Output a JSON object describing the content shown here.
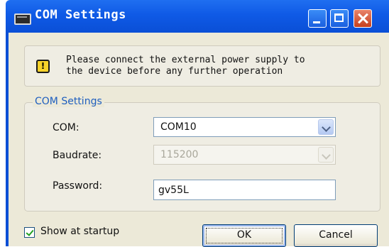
{
  "window": {
    "title": "COM Settings",
    "icon": "app-window-icon"
  },
  "title_buttons": {
    "minimize": "minimize-icon",
    "maximize": "maximize-icon",
    "close": "close-icon"
  },
  "warning": {
    "icon": "warning-icon",
    "icon_glyph": "!",
    "text": "Please connect the external power supply to\nthe device before any further operation"
  },
  "com_settings": {
    "legend": "COM Settings",
    "com_label": "COM:",
    "com_value": "COM10",
    "baudrate_label": "Baudrate:",
    "baudrate_value": "115200",
    "baudrate_enabled": false,
    "password_label": "Password:",
    "password_value": "gv55L"
  },
  "footer": {
    "show_at_startup_label": "Show at startup",
    "show_at_startup_checked": true,
    "ok_label": "OK",
    "cancel_label": "Cancel"
  },
  "colors": {
    "titlebar": "#0f5ae6",
    "group_legend": "#1f5fbf",
    "warning_icon": "#f6d22a",
    "close_button": "#c6401e"
  }
}
